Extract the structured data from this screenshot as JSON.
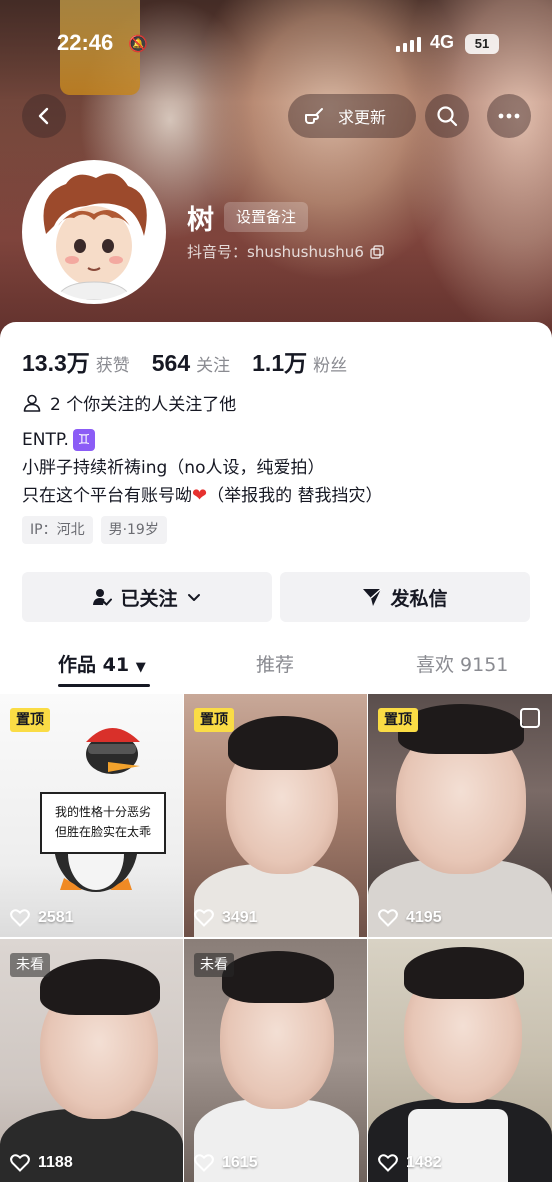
{
  "status_bar": {
    "time": "22:46",
    "network": "4G",
    "battery": "51"
  },
  "header": {
    "update_label": "求更新",
    "name": "树",
    "remark_label": "设置备注",
    "douyin_id": "抖音号：shushushushu6"
  },
  "stats": [
    {
      "value": "13.3万",
      "label": "获赞"
    },
    {
      "value": "564",
      "label": "关注"
    },
    {
      "value": "1.1万",
      "label": "粉丝"
    }
  ],
  "mutual": "2 个你关注的人关注了他",
  "bio": {
    "line1": "ENTP.",
    "zodiac": "♊",
    "line2": "小胖子持续祈祷ing（no人设，纯爱拍）",
    "line3": "只在这个平台有账号呦",
    "line3_after": "（举报我的 替我挡灾）"
  },
  "tags": [
    "IP：河北",
    "男·19岁"
  ],
  "actions": {
    "follow": "已关注",
    "message": "发私信"
  },
  "tabs": {
    "works": "作品 41",
    "recommend": "推荐",
    "likes": "喜欢 9151"
  },
  "videos": [
    {
      "badge": "置顶",
      "likes": "2581",
      "sign_line1": "我的性格十分恶劣",
      "sign_line2": "但胜在脸实在太乖"
    },
    {
      "badge": "置顶",
      "likes": "3491"
    },
    {
      "badge": "置顶",
      "likes": "4195"
    },
    {
      "badge": "未看",
      "likes": "1188"
    },
    {
      "badge": "未看",
      "likes": "1615"
    },
    {
      "badge": "",
      "likes": "1482"
    }
  ],
  "colors": {
    "pin_badge": "#fadc45",
    "heart": "#e6312f",
    "zodiac_bg": "#8b5cf6"
  }
}
